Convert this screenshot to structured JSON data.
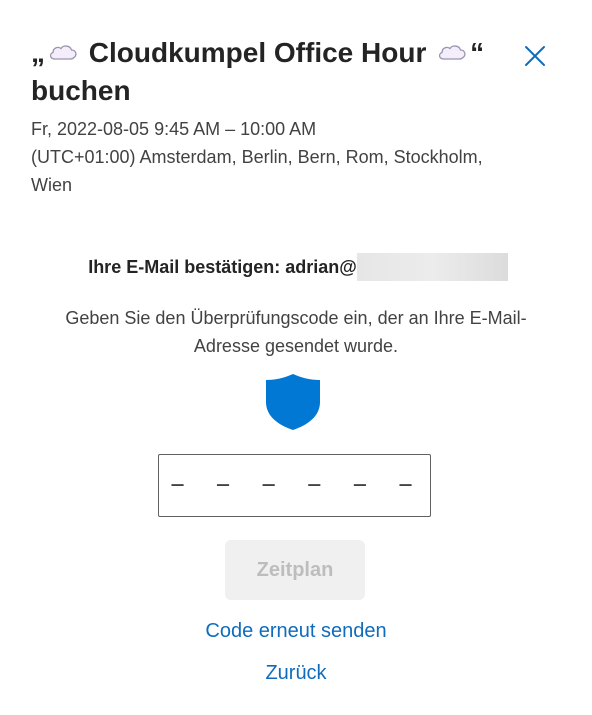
{
  "header": {
    "title_open_quote": "„",
    "title_name": "Cloudkumpel Office Hour",
    "title_close_quote": "“",
    "title_suffix": "buchen",
    "close_icon": "close-icon",
    "title_icons": [
      "cloud-icon",
      "cloud-icon"
    ]
  },
  "booking": {
    "datetime": "Fr, 2022-08-05 9:45 AM – 10:00 AM",
    "timezone": "(UTC+01:00) Amsterdam, Berlin, Bern, Rom, Stockholm, Wien"
  },
  "verification": {
    "confirm_label": "Ihre E-Mail bestätigen: adrian@",
    "instructions": "Geben Sie den Überprüfungscode ein, der an Ihre E-Mail-Adresse gesendet wurde.",
    "shield_icon": "shield-icon",
    "code_placeholder": "– – – – – –",
    "code_value": ""
  },
  "actions": {
    "schedule_label": "Zeitplan",
    "resend_label": "Code erneut senden",
    "back_label": "Zurück"
  },
  "colors": {
    "accent": "#0f6cbd",
    "shield": "#0078d4",
    "disabled_bg": "#f0f0f0",
    "disabled_text": "#bdbdbd"
  }
}
